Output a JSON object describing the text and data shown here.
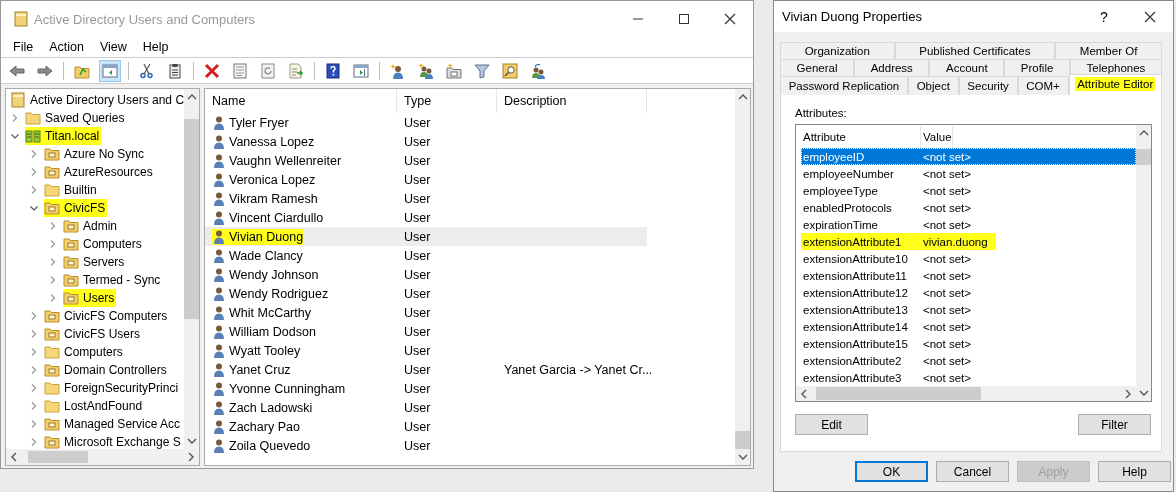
{
  "main_window": {
    "title": "Active Directory Users and Computers",
    "menu": [
      "File",
      "Action",
      "View",
      "Help"
    ],
    "toolbar": [
      {
        "kind": "back",
        "pressed": false
      },
      {
        "kind": "forward",
        "pressed": false
      },
      {
        "kind": "separator"
      },
      {
        "kind": "up",
        "pressed": false
      },
      {
        "kind": "console",
        "pressed": true
      },
      {
        "kind": "separator"
      },
      {
        "kind": "cut",
        "pressed": false
      },
      {
        "kind": "paste",
        "pressed": false
      },
      {
        "kind": "separator"
      },
      {
        "kind": "delete",
        "pressed": false
      },
      {
        "kind": "properties",
        "pressed": false
      },
      {
        "kind": "refresh",
        "pressed": false
      },
      {
        "kind": "export",
        "pressed": false
      },
      {
        "kind": "separator"
      },
      {
        "kind": "help",
        "pressed": false
      },
      {
        "kind": "pane",
        "pressed": false
      },
      {
        "kind": "separator"
      },
      {
        "kind": "new-user",
        "pressed": false
      },
      {
        "kind": "new-group",
        "pressed": false
      },
      {
        "kind": "new-ou",
        "pressed": false
      },
      {
        "kind": "filter",
        "pressed": false
      },
      {
        "kind": "find",
        "pressed": false
      },
      {
        "kind": "add-group",
        "pressed": false
      }
    ],
    "tree": {
      "root": {
        "label": "Active Directory Users and C",
        "kind": "root",
        "highlighted": false,
        "children": [
          {
            "label": "Saved Queries",
            "kind": "folder",
            "expanded": false,
            "highlighted": false
          },
          {
            "label": "Titan.local",
            "kind": "domain",
            "expanded": true,
            "highlighted": true,
            "children": [
              {
                "label": "Azure No Sync",
                "kind": "ou",
                "expanded": false,
                "highlighted": false
              },
              {
                "label": "AzureResources",
                "kind": "ou",
                "expanded": false,
                "highlighted": false
              },
              {
                "label": "Builtin",
                "kind": "folder",
                "expanded": false,
                "highlighted": false
              },
              {
                "label": "CivicFS",
                "kind": "ou",
                "expanded": true,
                "highlighted": true,
                "children": [
                  {
                    "label": "Admin",
                    "kind": "ou",
                    "expanded": false,
                    "highlighted": false
                  },
                  {
                    "label": "Computers",
                    "kind": "ou",
                    "expanded": false,
                    "highlighted": false
                  },
                  {
                    "label": "Servers",
                    "kind": "ou",
                    "expanded": false,
                    "highlighted": false
                  },
                  {
                    "label": "Termed - Sync",
                    "kind": "ou",
                    "expanded": false,
                    "highlighted": false
                  },
                  {
                    "label": "Users",
                    "kind": "ou",
                    "expanded": false,
                    "highlighted": true
                  }
                ]
              },
              {
                "label": "CivicFS Computers",
                "kind": "ou",
                "expanded": false,
                "highlighted": false
              },
              {
                "label": "CivicFS Users",
                "kind": "ou",
                "expanded": false,
                "highlighted": false
              },
              {
                "label": "Computers",
                "kind": "folder",
                "expanded": false,
                "highlighted": false
              },
              {
                "label": "Domain Controllers",
                "kind": "ou",
                "expanded": false,
                "highlighted": false
              },
              {
                "label": "ForeignSecurityPrinci",
                "kind": "folder",
                "expanded": false,
                "highlighted": false
              },
              {
                "label": "LostAndFound",
                "kind": "folder",
                "expanded": false,
                "highlighted": false
              },
              {
                "label": "Managed Service Acc",
                "kind": "ou",
                "expanded": false,
                "highlighted": false
              },
              {
                "label": "Microsoft Exchange S",
                "kind": "ou",
                "expanded": false,
                "highlighted": false
              }
            ]
          }
        ]
      }
    },
    "list": {
      "columns": [
        "Name",
        "Type",
        "Description"
      ],
      "rows": [
        {
          "name": "Tyler Fryer",
          "type": "User",
          "selected": false,
          "highlighted": false
        },
        {
          "name": "Vanessa Lopez",
          "type": "User",
          "selected": false,
          "highlighted": false
        },
        {
          "name": "Vaughn Wellenreiter",
          "type": "User",
          "selected": false,
          "highlighted": false
        },
        {
          "name": "Veronica Lopez",
          "type": "User",
          "selected": false,
          "highlighted": false
        },
        {
          "name": "Vikram Ramesh",
          "type": "User",
          "selected": false,
          "highlighted": false
        },
        {
          "name": "Vincent Ciardullo",
          "type": "User",
          "selected": false,
          "highlighted": false
        },
        {
          "name": "Vivian Duong",
          "type": "User",
          "selected": true,
          "highlighted": true
        },
        {
          "name": "Wade Clancy",
          "type": "User",
          "selected": false,
          "highlighted": false
        },
        {
          "name": "Wendy Johnson",
          "type": "User",
          "selected": false,
          "highlighted": false
        },
        {
          "name": "Wendy Rodriguez",
          "type": "User",
          "selected": false,
          "highlighted": false
        },
        {
          "name": "Whit McCarthy",
          "type": "User",
          "selected": false,
          "highlighted": false
        },
        {
          "name": "William Dodson",
          "type": "User",
          "selected": false,
          "highlighted": false
        },
        {
          "name": "Wyatt Tooley",
          "type": "User",
          "selected": false,
          "highlighted": false
        },
        {
          "name": "Yanet Cruz",
          "type": "User",
          "description": "Yanet Garcia -> Yanet Cr...",
          "selected": false,
          "highlighted": false
        },
        {
          "name": "Yvonne Cunningham",
          "type": "User",
          "selected": false,
          "highlighted": false
        },
        {
          "name": "Zach Ladowski",
          "type": "User",
          "selected": false,
          "highlighted": false
        },
        {
          "name": "Zachary Pao",
          "type": "User",
          "selected": false,
          "highlighted": false
        },
        {
          "name": "Zoila Quevedo",
          "type": "User",
          "selected": false,
          "highlighted": false
        }
      ]
    }
  },
  "dialog": {
    "title": "Vivian Duong Properties",
    "help_glyph": "?",
    "tab_rows": [
      [
        {
          "label": "Organization",
          "selected": false,
          "highlighted": false
        },
        {
          "label": "Published Certificates",
          "selected": false,
          "highlighted": false
        },
        {
          "label": "Member Of",
          "selected": false,
          "highlighted": false
        }
      ],
      [
        {
          "label": "General",
          "selected": false,
          "highlighted": false
        },
        {
          "label": "Address",
          "selected": false,
          "highlighted": false
        },
        {
          "label": "Account",
          "selected": false,
          "highlighted": false
        },
        {
          "label": "Profile",
          "selected": false,
          "highlighted": false
        },
        {
          "label": "Telephones",
          "selected": false,
          "highlighted": false
        }
      ],
      [
        {
          "label": "Password Replication",
          "selected": false,
          "highlighted": false
        },
        {
          "label": "Object",
          "selected": false,
          "highlighted": false
        },
        {
          "label": "Security",
          "selected": false,
          "highlighted": false
        },
        {
          "label": "COM+",
          "selected": false,
          "highlighted": false
        },
        {
          "label": "Attribute Editor",
          "selected": true,
          "highlighted": true
        }
      ]
    ],
    "attributes_label": "Attributes:",
    "columns": [
      "Attribute",
      "Value"
    ],
    "rows": [
      {
        "attribute": "employeeID",
        "value": "<not set>",
        "selected": true,
        "highlighted": false
      },
      {
        "attribute": "employeeNumber",
        "value": "<not set>",
        "selected": false,
        "highlighted": false
      },
      {
        "attribute": "employeeType",
        "value": "<not set>",
        "selected": false,
        "highlighted": false
      },
      {
        "attribute": "enabledProtocols",
        "value": "<not set>",
        "selected": false,
        "highlighted": false
      },
      {
        "attribute": "expirationTime",
        "value": "<not set>",
        "selected": false,
        "highlighted": false
      },
      {
        "attribute": "extensionAttribute1",
        "value": "vivian.duong",
        "selected": false,
        "highlighted": true
      },
      {
        "attribute": "extensionAttribute10",
        "value": "<not set>",
        "selected": false,
        "highlighted": false
      },
      {
        "attribute": "extensionAttribute11",
        "value": "<not set>",
        "selected": false,
        "highlighted": false
      },
      {
        "attribute": "extensionAttribute12",
        "value": "<not set>",
        "selected": false,
        "highlighted": false
      },
      {
        "attribute": "extensionAttribute13",
        "value": "<not set>",
        "selected": false,
        "highlighted": false
      },
      {
        "attribute": "extensionAttribute14",
        "value": "<not set>",
        "selected": false,
        "highlighted": false
      },
      {
        "attribute": "extensionAttribute15",
        "value": "<not set>",
        "selected": false,
        "highlighted": false
      },
      {
        "attribute": "extensionAttribute2",
        "value": "<not set>",
        "selected": false,
        "highlighted": false
      },
      {
        "attribute": "extensionAttribute3",
        "value": "<not set>",
        "selected": false,
        "highlighted": false
      }
    ],
    "panel_buttons": [
      "Edit",
      "Filter"
    ],
    "buttons": [
      {
        "label": "OK",
        "default": true,
        "disabled": false
      },
      {
        "label": "Cancel",
        "default": false,
        "disabled": false
      },
      {
        "label": "Apply",
        "default": false,
        "disabled": true
      },
      {
        "label": "Help",
        "default": false,
        "disabled": false
      }
    ]
  }
}
